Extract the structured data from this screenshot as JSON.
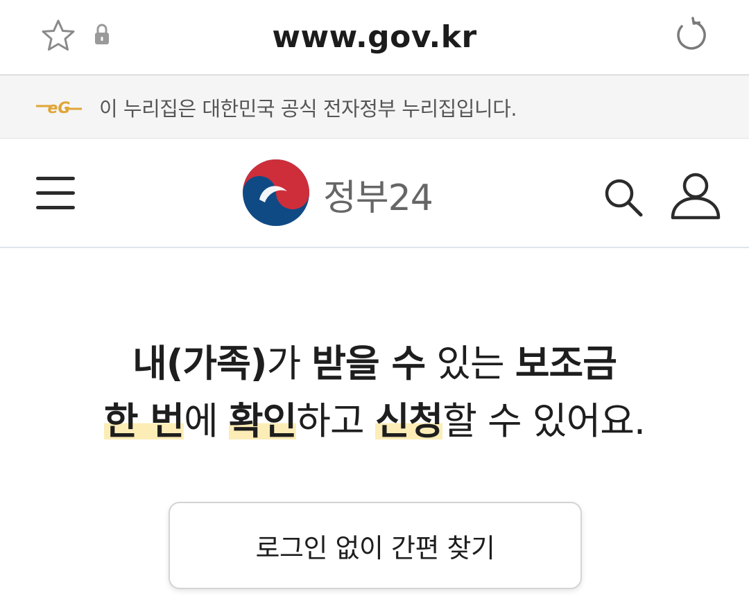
{
  "browser": {
    "url": "www.gov.kr"
  },
  "banner": {
    "logo_text": "eG",
    "text": "이 누리집은 대한민국 공식 전자정부 누리집입니다."
  },
  "header": {
    "brand_name": "정부24"
  },
  "hero": {
    "line1": {
      "part1": "내(가족)",
      "part2": "가 ",
      "part3": "받을 수",
      "part4": " 있는 ",
      "part5": "보조금"
    },
    "line2": {
      "part1": "한 번",
      "part2": "에 ",
      "part3": "확인",
      "part4": "하고 ",
      "part5": "신청",
      "part6": "할 수 있어요."
    }
  },
  "quick_find": {
    "label": "로그인 없이 간편 찾기"
  },
  "colors": {
    "accent_gold": "#e0a537",
    "taeguk_red": "#cd2e3a",
    "taeguk_blue": "#0f4a85",
    "highlight": "#fcedb7"
  },
  "icons": {
    "star": "star-icon",
    "lock": "lock-icon",
    "reload": "reload-icon",
    "menu": "menu-icon",
    "search": "search-icon",
    "user": "user-icon"
  }
}
